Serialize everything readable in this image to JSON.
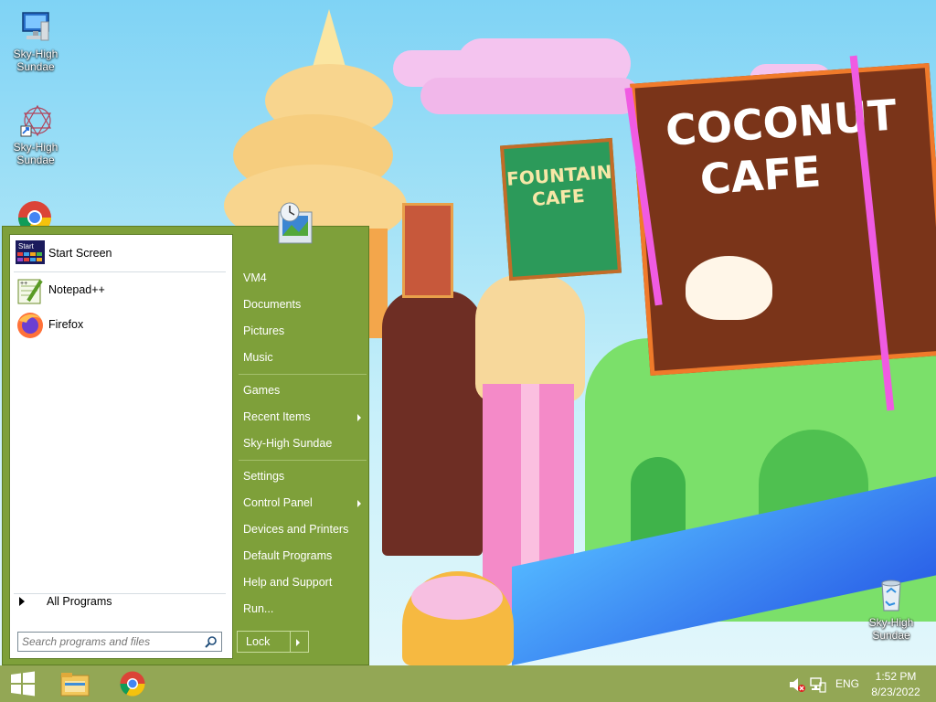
{
  "desktop": {
    "icons": [
      {
        "label": "Sky-High\nSundae",
        "icon": "computer-icon"
      },
      {
        "label": "Sky-High\nSundae",
        "icon": "shortcut-icon"
      },
      {
        "label": "Sky-High\nSundae",
        "icon": "recycle-bin-icon"
      }
    ],
    "wallpaper_signs": {
      "coconut": "COCONUT\nCAFE",
      "fountain": "FOUNTAIN\nCAFE"
    }
  },
  "start_menu": {
    "pinned": [
      {
        "label": "Start Screen",
        "icon": "start-screen-icon",
        "icon_text": "Start"
      },
      {
        "label": "Notepad++",
        "icon": "notepadpp-icon"
      },
      {
        "label": "Firefox",
        "icon": "firefox-icon"
      }
    ],
    "all_programs": "All Programs",
    "search_placeholder": "Search programs and files",
    "right": {
      "group1": [
        "VM4",
        "Documents",
        "Pictures",
        "Music"
      ],
      "group2": [
        "Games",
        "Recent Items",
        "Sky-High Sundae"
      ],
      "group3": [
        "Settings",
        "Control Panel",
        "Devices and Printers",
        "Default Programs",
        "Help and Support",
        "Run..."
      ]
    },
    "lock_label": "Lock"
  },
  "taskbar": {
    "apps": [
      "start-icon",
      "file-explorer-icon",
      "chrome-icon"
    ],
    "language": "ENG",
    "time": "1:52 PM",
    "date": "8/23/2022"
  },
  "colors": {
    "menu_green": "#7ea03a",
    "taskbar": "#8ca046"
  }
}
